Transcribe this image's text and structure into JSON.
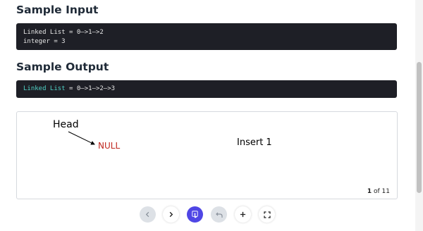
{
  "sample_input": {
    "heading": "Sample Input",
    "lines": [
      "Linked List = 0–>1–>2",
      "integer = 3"
    ]
  },
  "sample_output": {
    "heading": "Sample Output",
    "keyword": "Linked List",
    "rest": " = 0–>1–>2–>3"
  },
  "visualizer": {
    "head_label": "Head",
    "null_label": "NULL",
    "step_title": "Insert 1",
    "current_step": "1",
    "of_label": "of",
    "total_steps": "11"
  },
  "controls": [
    "prev-icon",
    "next-icon",
    "hand-pointer-icon",
    "undo-icon",
    "plus-icon",
    "fullscreen-icon"
  ],
  "colors": {
    "code_bg": "#1e1f26",
    "keyword": "#4fd1c5",
    "null": "#c0271f",
    "primary": "#4f46e5"
  }
}
